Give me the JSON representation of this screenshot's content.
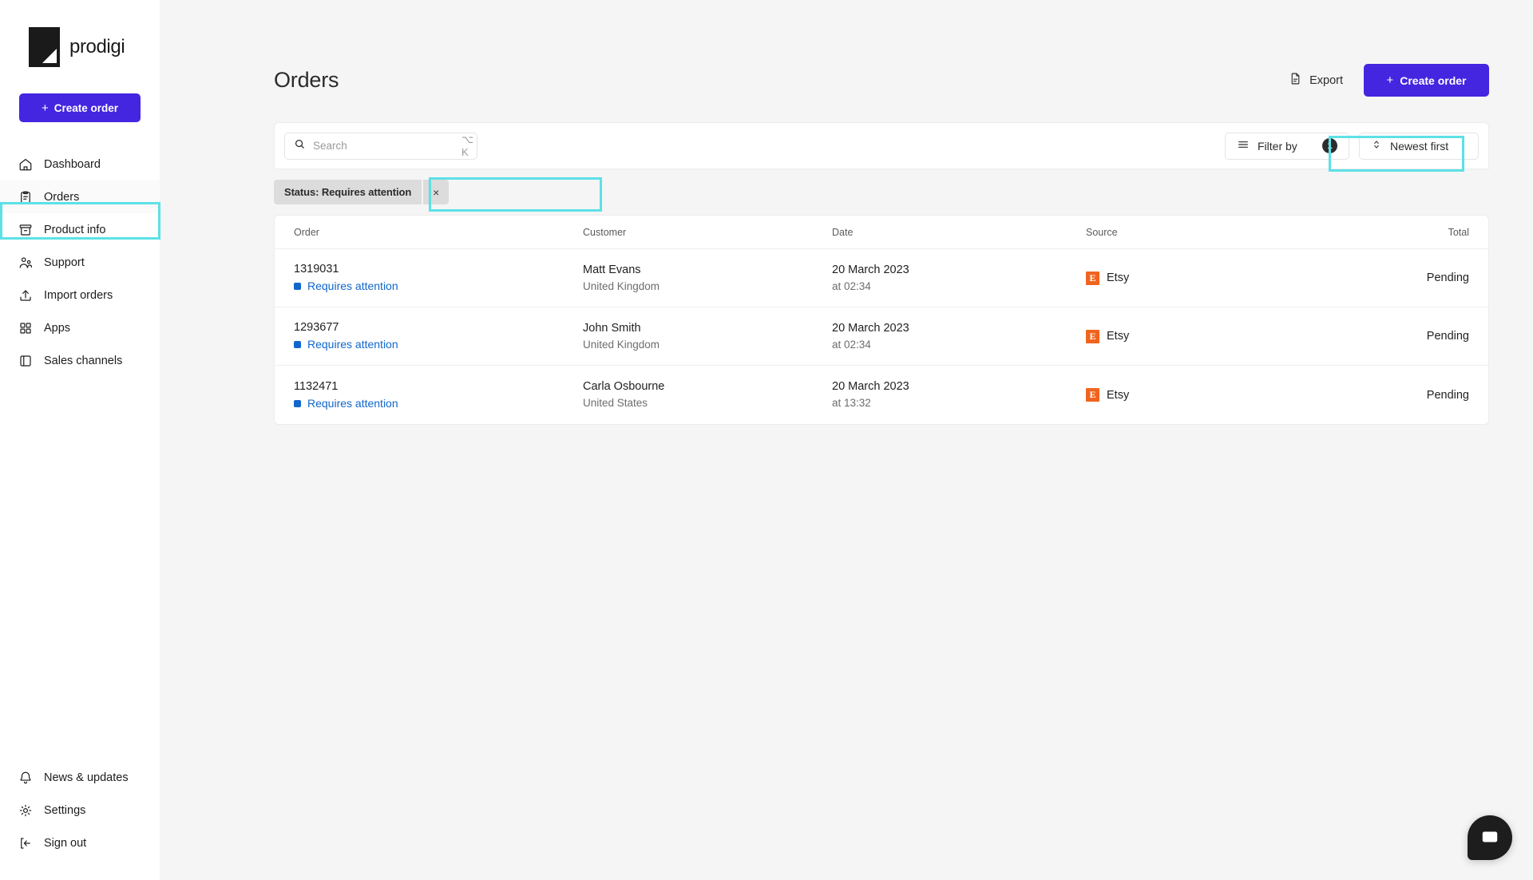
{
  "brand": {
    "name": "prodigi",
    "logo_icon": "prodigi-logo-icon",
    "accent_color": "#4425e0",
    "highlight_color": "#5ce1e6"
  },
  "sidebar": {
    "create_order_label": "Create order",
    "top_items": [
      {
        "label": "Dashboard",
        "icon": "home-icon",
        "active": false
      },
      {
        "label": "Orders",
        "icon": "clipboard-icon",
        "active": true
      },
      {
        "label": "Product info",
        "icon": "archive-box-icon",
        "active": false
      },
      {
        "label": "Support",
        "icon": "people-icon",
        "active": false
      },
      {
        "label": "Import orders",
        "icon": "upload-icon",
        "active": false
      },
      {
        "label": "Apps",
        "icon": "grid-apps-icon",
        "active": false
      },
      {
        "label": "Sales channels",
        "icon": "store-icon",
        "active": false
      }
    ],
    "bottom_items": [
      {
        "label": "News & updates",
        "icon": "bell-icon"
      },
      {
        "label": "Settings",
        "icon": "gear-icon"
      },
      {
        "label": "Sign out",
        "icon": "sign-out-icon"
      }
    ]
  },
  "header": {
    "title": "Orders",
    "export_label": "Export",
    "export_icon": "document-icon",
    "create_order_label": "Create order"
  },
  "toolbar": {
    "search_placeholder": "Search",
    "search_value": "",
    "search_icon": "search-icon",
    "search_shortcut": "⌥ K",
    "filter_label": "Filter by",
    "filter_icon": "filter-lines-icon",
    "filter_count": "1",
    "sort_label": "Newest first",
    "sort_icon": "sort-updown-icon"
  },
  "filter_chips": [
    {
      "label": "Status: Requires attention",
      "remove_icon": "close-icon",
      "remove_label": "×"
    }
  ],
  "table": {
    "columns": [
      {
        "key": "order",
        "label": "Order"
      },
      {
        "key": "customer",
        "label": "Customer"
      },
      {
        "key": "date",
        "label": "Date"
      },
      {
        "key": "source",
        "label": "Source"
      },
      {
        "key": "total",
        "label": "Total"
      }
    ],
    "rows": [
      {
        "order_id": "1319031",
        "status": "Requires attention",
        "customer_name": "Matt Evans",
        "customer_country": "United Kingdom",
        "date": "20 March 2023",
        "time": "at 02:34",
        "source": "Etsy",
        "source_icon": "etsy-icon",
        "total": "Pending"
      },
      {
        "order_id": "1293677",
        "status": "Requires attention",
        "customer_name": "John Smith",
        "customer_country": "United Kingdom",
        "date": "20 March 2023",
        "time": "at 02:34",
        "source": "Etsy",
        "source_icon": "etsy-icon",
        "total": "Pending"
      },
      {
        "order_id": "1132471",
        "status": "Requires attention",
        "customer_name": "Carla Osbourne",
        "customer_country": "United States",
        "date": "20 March 2023",
        "time": "at 13:32",
        "source": "Etsy",
        "source_icon": "etsy-icon",
        "total": "Pending"
      }
    ]
  },
  "chat_widget": {
    "icon": "chat-bubble-icon"
  }
}
